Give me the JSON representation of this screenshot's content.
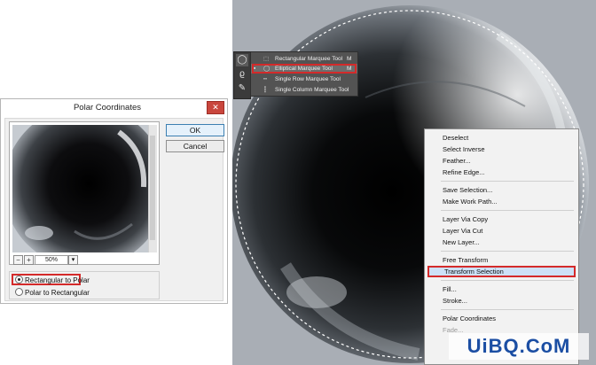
{
  "dialog": {
    "title": "Polar Coordinates",
    "close_glyph": "✕",
    "ok_label": "OK",
    "cancel_label": "Cancel",
    "zoom_minus": "−",
    "zoom_plus": "+",
    "zoom_value": "50%",
    "zoom_dropdown_icon": "chevron-down-icon",
    "options": [
      {
        "label": "Rectangular to Polar",
        "selected": true
      },
      {
        "label": "Polar to Rectangular",
        "selected": false
      }
    ]
  },
  "tools": {
    "items": [
      {
        "name": "elliptical-marquee-icon",
        "glyph": "◯"
      },
      {
        "name": "lasso-icon",
        "glyph": "ϱ"
      },
      {
        "name": "brush-icon",
        "glyph": "✎"
      }
    ]
  },
  "marquee_flyout": {
    "items": [
      {
        "label": "Rectangular Marquee Tool",
        "shortcut": "M",
        "icon": "rectangle-marquee-icon",
        "glyph": "⬚",
        "selected": false
      },
      {
        "label": "Elliptical Marquee Tool",
        "shortcut": "M",
        "icon": "elliptical-marquee-icon",
        "glyph": "◯",
        "selected": true
      },
      {
        "label": "Single Row Marquee Tool",
        "shortcut": "",
        "icon": "single-row-marquee-icon",
        "glyph": "┅",
        "selected": false
      },
      {
        "label": "Single Column Marquee Tool",
        "shortcut": "",
        "icon": "single-column-marquee-icon",
        "glyph": "┇",
        "selected": false
      }
    ]
  },
  "context_menu": {
    "items": [
      {
        "label": "Deselect"
      },
      {
        "label": "Select Inverse"
      },
      {
        "label": "Feather..."
      },
      {
        "label": "Refine Edge..."
      },
      {
        "sep": true
      },
      {
        "label": "Save Selection..."
      },
      {
        "label": "Make Work Path..."
      },
      {
        "sep": true
      },
      {
        "label": "Layer Via Copy"
      },
      {
        "label": "Layer Via Cut"
      },
      {
        "label": "New Layer..."
      },
      {
        "sep": true
      },
      {
        "label": "Free Transform"
      },
      {
        "label": "Transform Selection",
        "highlighted": true
      },
      {
        "sep": true
      },
      {
        "label": "Fill..."
      },
      {
        "label": "Stroke..."
      },
      {
        "sep": true
      },
      {
        "label": "Polar Coordinates"
      },
      {
        "label": "Fade...",
        "disabled": true
      }
    ]
  },
  "watermark": "UiBQ.CoM",
  "colors": {
    "highlight_border": "#d42a2a",
    "canvas_bg": "#a7acb3",
    "flyout_bg": "#535353"
  }
}
